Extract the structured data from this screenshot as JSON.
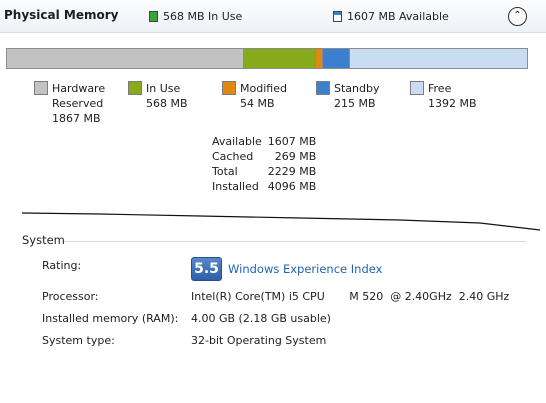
{
  "header": {
    "title": "Physical Memory",
    "in_use_text": "568 MB In Use",
    "available_text": "1607 MB Available",
    "collapse_glyph": "⌃"
  },
  "colors": {
    "hardware": "#c2c2c2",
    "in_use": "#87a91c",
    "modified": "#e0880f",
    "standby": "#3d7fcf",
    "free": "#c9dcf2",
    "link": "#1f64b4"
  },
  "memory_bar": {
    "total_mb": 4096,
    "segments": [
      {
        "key": "hardware",
        "mb": 1867
      },
      {
        "key": "in_use",
        "mb": 568
      },
      {
        "key": "modified",
        "mb": 54
      },
      {
        "key": "standby",
        "mb": 215
      },
      {
        "key": "free",
        "mb": 1392
      }
    ]
  },
  "legend": [
    {
      "key": "hardware",
      "line1": "Hardware",
      "line2": "Reserved",
      "line3": "1867 MB"
    },
    {
      "key": "in_use",
      "line1": "In Use",
      "line2": "568 MB",
      "line3": ""
    },
    {
      "key": "modified",
      "line1": "Modified",
      "line2": "54 MB",
      "line3": ""
    },
    {
      "key": "standby",
      "line1": "Standby",
      "line2": "215 MB",
      "line3": ""
    },
    {
      "key": "free",
      "line1": "Free",
      "line2": "1392 MB",
      "line3": ""
    }
  ],
  "stats": [
    {
      "label": "Available",
      "value": "1607 MB"
    },
    {
      "label": "Cached",
      "value": "269 MB"
    },
    {
      "label": "Total",
      "value": "2229 MB"
    },
    {
      "label": "Installed",
      "value": "4096 MB"
    }
  ],
  "system": {
    "section_title": "System",
    "rating_label": "Rating:",
    "wei_score": "5.5",
    "wei_link": "Windows Experience Index",
    "processor_label": "Processor:",
    "processor_value": "Intel(R) Core(TM) i5 CPU       M 520  @ 2.40GHz  2.40 GHz",
    "memory_label": "Installed memory (RAM):",
    "memory_value": "4.00 GB (2.18 GB usable)",
    "type_label": "System type:",
    "type_value": "32-bit Operating System"
  }
}
